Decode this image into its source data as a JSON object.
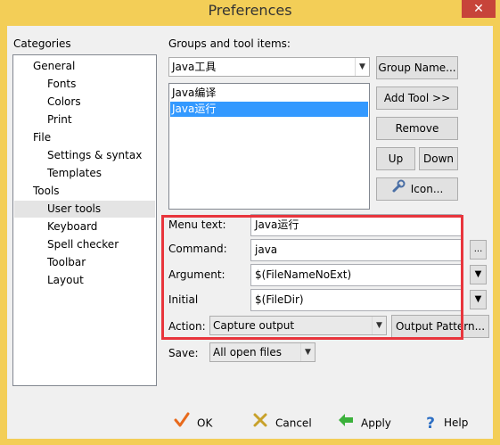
{
  "window": {
    "title": "Preferences",
    "close_glyph": "✕"
  },
  "categories": {
    "label": "Categories",
    "items": [
      {
        "label": "General",
        "level": 0
      },
      {
        "label": "Fonts",
        "level": 1
      },
      {
        "label": "Colors",
        "level": 1
      },
      {
        "label": "Print",
        "level": 1
      },
      {
        "label": "File",
        "level": 0
      },
      {
        "label": "Settings & syntax",
        "level": 1
      },
      {
        "label": "Templates",
        "level": 1
      },
      {
        "label": "Tools",
        "level": 0
      },
      {
        "label": "User tools",
        "level": 1,
        "selected": true
      },
      {
        "label": "Keyboard",
        "level": 1
      },
      {
        "label": "Spell checker",
        "level": 1
      },
      {
        "label": "Toolbar",
        "level": 1
      },
      {
        "label": "Layout",
        "level": 1
      }
    ]
  },
  "groups": {
    "label": "Groups and tool items:",
    "selected_group": "Java工具",
    "items": [
      "Java编译",
      "Java运行"
    ],
    "selected_index": 1
  },
  "buttons": {
    "group_name": "Group Name...",
    "add_tool": "Add Tool >>",
    "remove": "Remove",
    "up": "Up",
    "down": "Down",
    "icon": "Icon..."
  },
  "form": {
    "menu_text_label": "Menu text:",
    "menu_text_value": "Java运行",
    "command_label": "Command:",
    "command_value": "java",
    "command_browse": "...",
    "argument_label": "Argument:",
    "argument_value": "$(FileNameNoExt)",
    "initial_label": "Initial",
    "initial_value": "$(FileDir)",
    "action_label": "Action:",
    "action_value": "Capture output",
    "output_pattern": "Output Pattern...",
    "save_label": "Save:",
    "save_value": "All open files"
  },
  "footer": {
    "ok": "OK",
    "cancel": "Cancel",
    "apply": "Apply",
    "help": "Help"
  },
  "colors": {
    "titlebar": "#f3ce57",
    "close": "#c7443a",
    "selection": "#3399ff",
    "highlight_box": "#e8353c"
  }
}
